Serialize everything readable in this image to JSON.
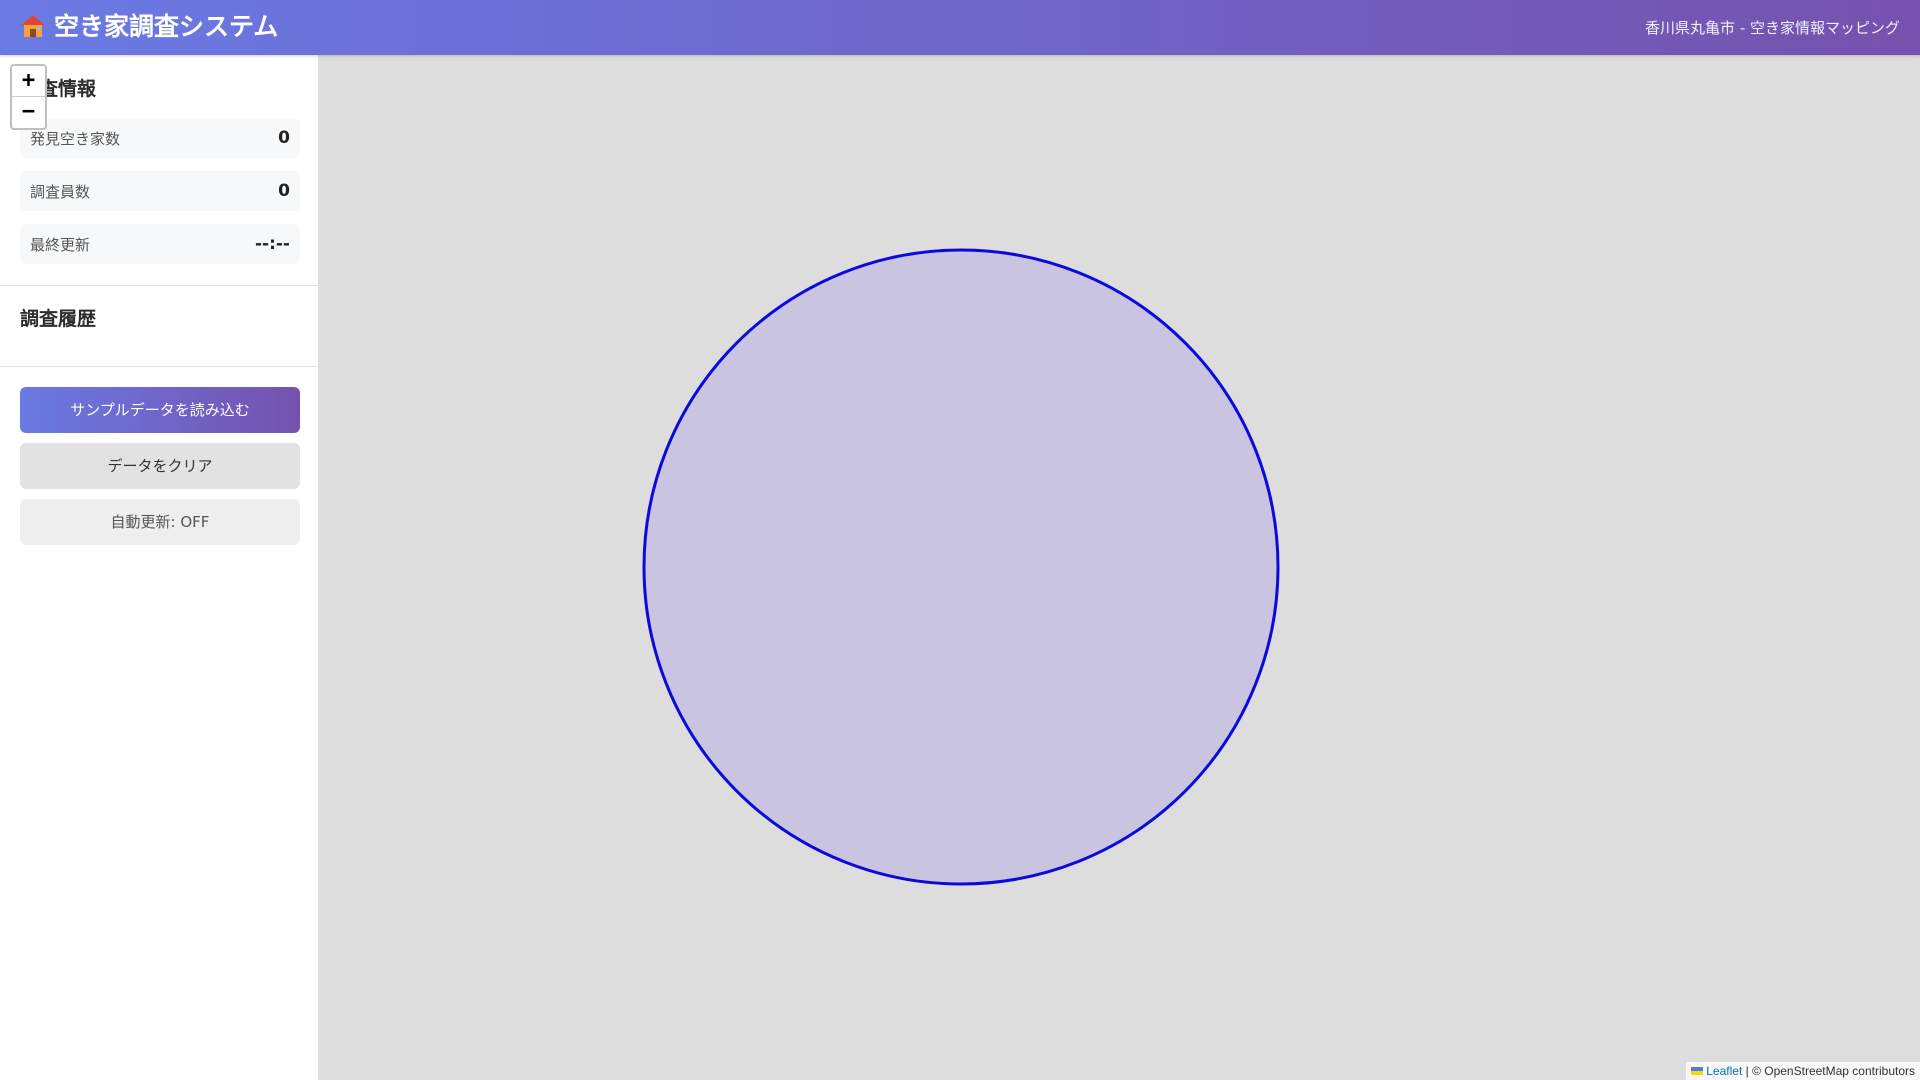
{
  "header": {
    "title": "空き家調査システム",
    "subtitle": "香川県丸亀市 - 空き家情報マッピング",
    "title_icon": "house-icon"
  },
  "sidebar": {
    "info_title": "調査情報",
    "stats": [
      {
        "label": "発見空き家数",
        "value": "0"
      },
      {
        "label": "調査員数",
        "value": "0"
      },
      {
        "label": "最終更新",
        "value": "--:--"
      }
    ],
    "history_title": "調査履歴",
    "buttons": {
      "load_sample": "サンプルデータを読み込む",
      "clear": "データをクリア",
      "auto_update": "自動更新: OFF"
    }
  },
  "map": {
    "zoom_in": "+",
    "zoom_out": "−",
    "circle": {
      "stroke": "#0a0adc",
      "fill": "#c9c4e0"
    },
    "attribution": {
      "leaflet": "Leaflet",
      "separator": " | ",
      "osm": "© OpenStreetMap contributors"
    }
  },
  "colors": {
    "accent_start": "#6a7ae4",
    "accent_end": "#7552ae",
    "map_background": "#dddddd"
  }
}
